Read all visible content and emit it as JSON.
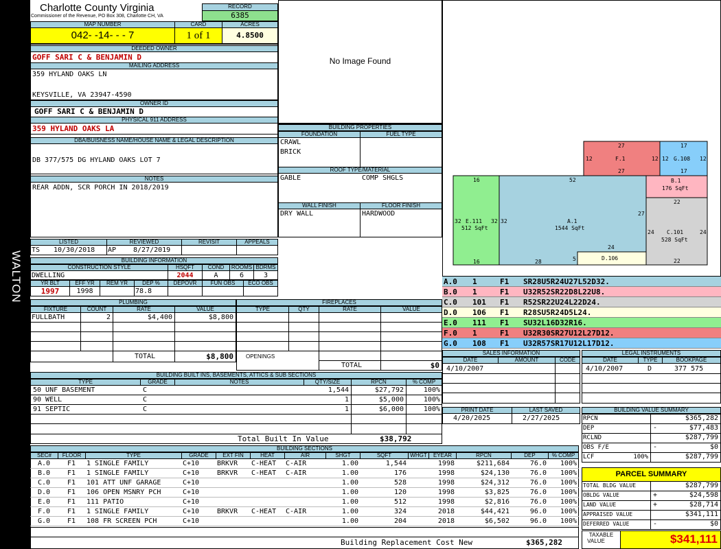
{
  "side_label": "WALTON",
  "county": {
    "name": "Charlotte County Virginia",
    "commissioner": "Commissioner of the Revenue, PO Box 308, Charlotte CH, VA"
  },
  "record": {
    "label": "RECORD",
    "value": "6385"
  },
  "map": {
    "map_label": "MAP NUMBER",
    "map_number": "042- -14- - - 7",
    "card_label": "CARD",
    "card": "1 of 1",
    "acres_label": "ACRES",
    "acres": "4.8500"
  },
  "owner": {
    "deeded_label": "DEEDED OWNER",
    "deeded": "GOFF SARI C & BENJAMIN D",
    "mailing_label": "MAILING ADDRESS",
    "mail1": "359 HYLAND OAKS LN",
    "mail2": "KEYSVILLE, VA 23947-4590",
    "owner_id_label": "OWNER ID",
    "owner_id": "GOFF SARI C & BENJAMIN D",
    "phys_label": "PHYSICAL 911 ADDRESS",
    "phys": "359 HYLAND OAKS LA"
  },
  "dba": {
    "label": "DBA/BUISNESS NAME/HOUSE NAME & LEGAL DESCRIPTION",
    "value": "DB 377/575 DG HYLAND OAKS LOT 7"
  },
  "notes": {
    "label": "NOTES",
    "value": "REAR ADDN, SCR PORCH IN 2018/2019"
  },
  "image": {
    "text": "No Image Found"
  },
  "building_props": {
    "label": "BUILDING PROPERTIES",
    "foundation_label": "FOUNDATION",
    "foundation1": "CRAWL",
    "foundation2": "BRICK",
    "fuel_label": "FUEL TYPE",
    "roof_label": "ROOF TYPE/MATERIAL",
    "roof1": "GABLE",
    "roof2": "COMP SHGLS",
    "wall_label": "WALL FINISH",
    "wall": "DRY WALL",
    "floor_label": "FLOOR FINISH",
    "floor": "HARDWOOD"
  },
  "listing": {
    "listed_label": "LISTED",
    "listed_by": "TS",
    "listed_date": "10/30/2018",
    "reviewed_label": "REVIEWED",
    "reviewed_by": "AP",
    "reviewed_date": "8/27/2019",
    "revisit_label": "REVISIT",
    "appeals_label": "APPEALS"
  },
  "building_info": {
    "label": "BUILDING INFORMATION",
    "style_label": "CONSTRUCTION STYLE",
    "style": "DWELLING",
    "hsqft_label": "HSQFT",
    "hsqft": "2044",
    "cond_label": "COND",
    "cond": "A",
    "rooms_label": "ROOMS",
    "rooms": "6",
    "bdrms_label": "BDRMS",
    "bdrms": "3",
    "yrblt_label": "YR BLT",
    "yrblt": "1997",
    "effyr_label": "EFF YR",
    "effyr": "1998",
    "remyr_label": "REM YR",
    "remyr": "",
    "dep_label": "DEP %",
    "dep": "78.8",
    "depovr_label": "DEPOVR",
    "funobs_label": "FUN OBS",
    "ecoobs_label": "ECO OBS"
  },
  "plumbing": {
    "label": "PLUMBING",
    "headers": [
      "FIXTURE",
      "COUNT",
      "RATE",
      "VALUE"
    ],
    "row": [
      "FULLBATH",
      "2",
      "$4,400",
      "$8,800"
    ],
    "total_label": "TOTAL",
    "total": "$8,800"
  },
  "fireplaces": {
    "label": "FIREPLACES",
    "headers": [
      "TYPE",
      "QTY",
      "RATE",
      "VALUE"
    ],
    "openings_label": "OPENINGS",
    "total_label": "TOTAL",
    "total": "$0"
  },
  "builtins": {
    "label": "BUILDING BUILT INS, BASEMENTS, ATTICS & SUB SECTIONS",
    "headers": [
      "TYPE",
      "GRADE",
      "NOTES",
      "QTY/SIZE",
      "RPCN",
      "% COMP"
    ],
    "rows": [
      [
        "50 UNF BASEMENT",
        "C",
        "",
        "1,544",
        "$27,792",
        "100%"
      ],
      [
        "90 WELL",
        "C",
        "",
        "1",
        "$5,000",
        "100%"
      ],
      [
        "91 SEPTIC",
        "C",
        "",
        "1",
        "$6,000",
        "100%"
      ]
    ],
    "total_label": "Total Built In Value",
    "total": "$38,792"
  },
  "sections": {
    "label": "BUILDING SECTIONS",
    "headers": [
      "SEC#",
      "FLOOR",
      "TYPE",
      "GRADE",
      "EXT FIN",
      "HEAT",
      "AIR",
      "SHGT",
      "SQFT",
      "WHGT",
      "EYEAR",
      "RPCN",
      "DEP",
      "% COMP"
    ],
    "rows": [
      [
        "A.0",
        "F1",
        "1 SINGLE FAMILY",
        "C+10",
        "BRKVR",
        "C-HEAT",
        "C-AIR",
        "1.00",
        "1,544",
        "",
        "1998",
        "$211,684",
        "76.0",
        "100%"
      ],
      [
        "B.0",
        "F1",
        "1 SINGLE FAMILY",
        "C+10",
        "BRKVR",
        "C-HEAT",
        "C-AIR",
        "1.00",
        "176",
        "",
        "1998",
        "$24,130",
        "76.0",
        "100%"
      ],
      [
        "C.0",
        "F1",
        "101 ATT UNF GARAGE",
        "C+10",
        "",
        "",
        "",
        "1.00",
        "528",
        "",
        "1998",
        "$24,312",
        "76.0",
        "100%"
      ],
      [
        "D.0",
        "F1",
        "106 OPEN MSNRY PCH",
        "C+10",
        "",
        "",
        "",
        "1.00",
        "120",
        "",
        "1998",
        "$3,825",
        "76.0",
        "100%"
      ],
      [
        "E.0",
        "F1",
        "111 PATIO",
        "C+10",
        "",
        "",
        "",
        "1.00",
        "512",
        "",
        "1998",
        "$2,816",
        "76.0",
        "100%"
      ],
      [
        "F.0",
        "F1",
        "1 SINGLE FAMILY",
        "C+10",
        "BRKVR",
        "C-HEAT",
        "C-AIR",
        "1.00",
        "324",
        "",
        "2018",
        "$44,421",
        "96.0",
        "100%"
      ],
      [
        "G.0",
        "F1",
        "108 FR SCREEN PCH",
        "C+10",
        "",
        "",
        "",
        "1.00",
        "204",
        "",
        "2018",
        "$6,502",
        "96.0",
        "100%"
      ]
    ],
    "rcn_label": "Building Replacement Cost New",
    "rcn": "$365,282"
  },
  "sketch": {
    "A": {
      "label": "A.1",
      "area": "1544 SqFt",
      "dims": [
        "52",
        "27",
        "24",
        "5",
        "28",
        "32"
      ]
    },
    "B": {
      "label": "B.1",
      "area": "176 SqFt",
      "dims": [
        "22"
      ]
    },
    "C": {
      "label": "C.101",
      "area": "528 SqFt",
      "dims": [
        "22",
        "24",
        "24",
        "22"
      ]
    },
    "D": {
      "label": "D.106"
    },
    "E": {
      "label": "E.111",
      "area": "512 SqFt",
      "dims": [
        "16",
        "32",
        "32",
        "16"
      ]
    },
    "F": {
      "label": "F.1",
      "dims": [
        "27",
        "12",
        "12",
        "27"
      ]
    },
    "G": {
      "label": "G.108",
      "dims": [
        "17",
        "12",
        "12",
        "17"
      ]
    }
  },
  "vectors": [
    {
      "sec": "A.0",
      "n": "1",
      "fl": "F1",
      "v": "SR28U5R24U27L52D32.",
      "color": "#a6d2e0"
    },
    {
      "sec": "B.0",
      "n": "1",
      "fl": "F1",
      "v": "U32R52SR22D8L22U8.",
      "color": "#ffb6c1"
    },
    {
      "sec": "C.0",
      "n": "101",
      "fl": "F1",
      "v": "R52SR22U24L22D24.",
      "color": "#d3d3d3"
    },
    {
      "sec": "D.0",
      "n": "106",
      "fl": "F1",
      "v": "R28SU5R24D5L24.",
      "color": "#ffffe0"
    },
    {
      "sec": "E.0",
      "n": "111",
      "fl": "F1",
      "v": "SU32L16D32R16.",
      "color": "#90ee90"
    },
    {
      "sec": "F.0",
      "n": "1",
      "fl": "F1",
      "v": "U32R30SR27U12L27D12.",
      "color": "#f08080"
    },
    {
      "sec": "G.0",
      "n": "108",
      "fl": "F1",
      "v": "U32R57SR17U12L17D12.",
      "color": "#87cefa"
    }
  ],
  "sales": {
    "label": "SALES INFORMATION",
    "headers": [
      "DATE",
      "AMOUNT",
      "CODE"
    ],
    "date": "4/10/2007"
  },
  "legal": {
    "label": "LEGAL INSTRUMENTS",
    "headers": [
      "DATE",
      "TYPE",
      "BOOKPAGE"
    ],
    "date": "4/10/2007",
    "type": "D",
    "book": "377 575"
  },
  "print": {
    "print_label": "PRINT DATE",
    "print_date": "4/20/2025",
    "saved_label": "LAST SAVED",
    "saved_date": "2/27/2025"
  },
  "bvs": {
    "label": "BUILDING VALUE SUMMARY",
    "rows": [
      {
        "k": "RPCN",
        "p": "",
        "s": "",
        "v": "$365,282"
      },
      {
        "k": "DEP",
        "p": "",
        "s": "-",
        "v": "$77,483"
      },
      {
        "k": "RCLND",
        "p": "",
        "s": "",
        "v": "$287,799"
      },
      {
        "k": "OBS F/E",
        "p": "",
        "s": "-",
        "v": "$0"
      },
      {
        "k": "LCF",
        "p": "100%",
        "s": "",
        "v": "$287,799"
      }
    ]
  },
  "parcel": {
    "label": "PARCEL SUMMARY",
    "rows": [
      {
        "k": "TOTAL BLDG VALUE",
        "s": "",
        "v": "$287,799"
      },
      {
        "k": "OBLDG VALUE",
        "s": "+",
        "v": "$24,598"
      },
      {
        "k": "LAND VALUE",
        "s": "+",
        "v": "$28,714"
      },
      {
        "k": "APPRAISED VALUE",
        "s": "",
        "v": "$341,111"
      },
      {
        "k": "DEFERRED VALUE",
        "s": "-",
        "v": "$0"
      }
    ],
    "taxable_label1": "TAXABLE",
    "taxable_label2": "VALUE",
    "taxable": "$341,111"
  }
}
